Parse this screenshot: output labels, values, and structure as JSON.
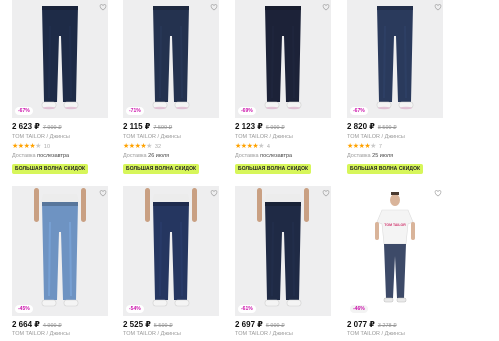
{
  "products": [
    {
      "discount": "-67%",
      "price": "2 623 ₽",
      "old_price": "7 999 ₽",
      "brand": "TOM TAILOR / Джинсы",
      "stars": 4,
      "reviews": "10",
      "delivery_label": "Доставка",
      "delivery_date": "послезавтра",
      "promo": "БОЛЬШАЯ ВОЛНА СКИДОК",
      "jeans": "#1e2b47"
    },
    {
      "discount": "-71%",
      "price": "2 115 ₽",
      "old_price": "7 599 ₽",
      "brand": "TOM TAILOR / Джинсы",
      "stars": 4,
      "reviews": "32",
      "delivery_label": "Доставка",
      "delivery_date": "26 июля",
      "promo": "БОЛЬШАЯ ВОЛНА СКИДОК",
      "jeans": "#24324f"
    },
    {
      "discount": "-69%",
      "price": "2 123 ₽",
      "old_price": "6 999 ₽",
      "brand": "TOM TAILOR / Джинсы",
      "stars": 4,
      "reviews": "4",
      "delivery_label": "Доставка",
      "delivery_date": "послезавтра",
      "promo": "БОЛЬШАЯ ВОЛНА СКИДОК",
      "jeans": "#1c2238"
    },
    {
      "discount": "-67%",
      "price": "2 820 ₽",
      "old_price": "8 599 ₽",
      "brand": "TOM TAILOR / Джинсы",
      "stars": 4,
      "reviews": "7",
      "delivery_label": "Доставка",
      "delivery_date": "25 июля",
      "promo": "БОЛЬШАЯ ВОЛНА СКИДОК",
      "jeans": "#2a3a5c"
    },
    {
      "discount": "-45%",
      "price": "2 664 ₽",
      "old_price": "4 999 ₽",
      "brand": "TOM TAILOR / Джинсы",
      "jeans": "#6e93c2"
    },
    {
      "discount": "-54%",
      "price": "2 525 ₽",
      "old_price": "5 599 ₽",
      "brand": "TOM TAILOR / Джинсы",
      "jeans": "#253660"
    },
    {
      "discount": "-61%",
      "price": "2 697 ₽",
      "old_price": "6 999 ₽",
      "brand": "TOM TAILOR / Джинсы",
      "jeans": "#1f2a45"
    },
    {
      "discount": "-46%",
      "price": "2 077 ₽",
      "old_price": "3 278 ₽",
      "brand": "TOM TAILOR / Джинсы",
      "jeans": "#3d4a68",
      "shirt": "#f4f4f4",
      "shirt_text": "TOM TAILOR"
    }
  ]
}
